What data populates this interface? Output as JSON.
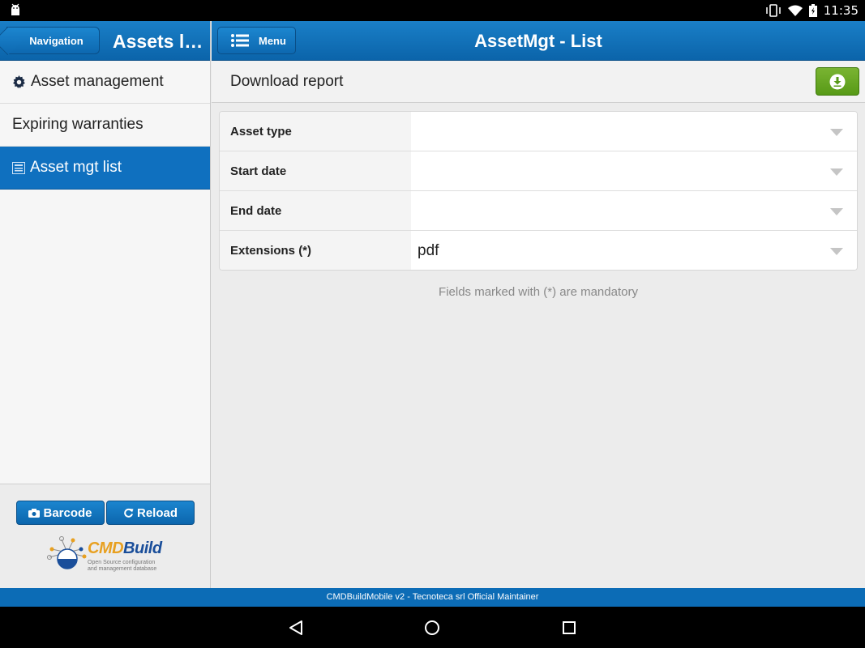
{
  "status_bar": {
    "time": "11:35"
  },
  "left_panel": {
    "nav_button": "Navigation",
    "title": "Assets li...",
    "items": [
      {
        "label": "Asset management",
        "icon": "gear-icon",
        "active": false
      },
      {
        "label": "Expiring warranties",
        "icon": "",
        "active": false
      },
      {
        "label": "Asset mgt list",
        "icon": "list-icon",
        "active": true
      }
    ],
    "barcode_button": "Barcode",
    "reload_button": "Reload",
    "logo": {
      "name_part1": "CMD",
      "name_part2": "Build",
      "tagline": "Open Source configuration and management database"
    }
  },
  "header": {
    "menu_button": "Menu",
    "title": "AssetMgt - List"
  },
  "subbar": {
    "label": "Download report"
  },
  "form": {
    "fields": [
      {
        "label": "Asset type",
        "value": ""
      },
      {
        "label": "Start date",
        "value": ""
      },
      {
        "label": "End date",
        "value": ""
      },
      {
        "label": "Extensions (*)",
        "value": "pdf"
      }
    ],
    "note": "Fields marked with (*) are mandatory"
  },
  "footer": {
    "text": "CMDBuildMobile v2 - Tecnoteca srl Official Maintainer"
  },
  "colors": {
    "header_blue": "#0f70bf",
    "download_green": "#6aab27"
  }
}
